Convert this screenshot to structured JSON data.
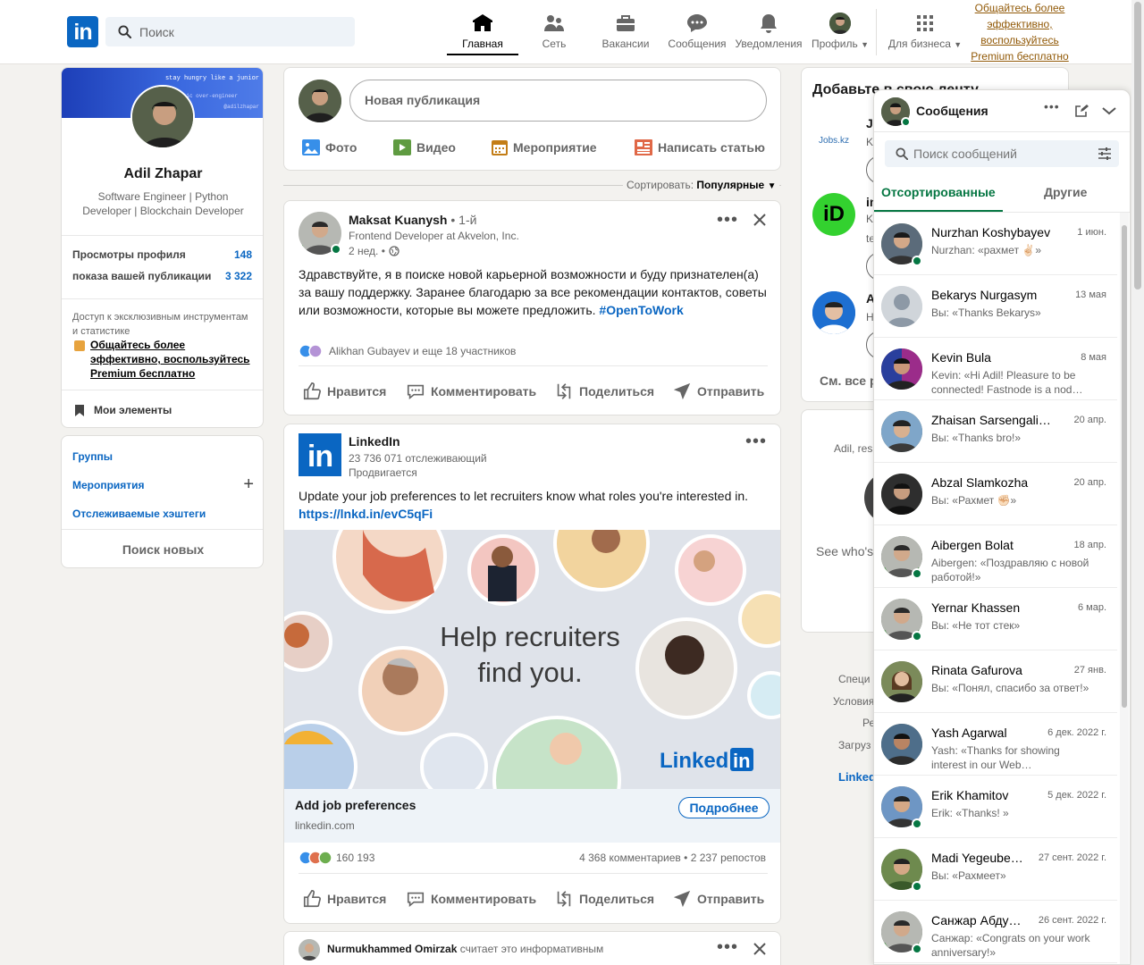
{
  "nav": {
    "search_placeholder": "Поиск",
    "items": [
      {
        "label": "Главная"
      },
      {
        "label": "Сеть"
      },
      {
        "label": "Вакансии"
      },
      {
        "label": "Сообщения"
      },
      {
        "label": "Уведомления"
      },
      {
        "label": "Профиль"
      },
      {
        "label": "Для бизнеса"
      }
    ],
    "premium_link": "Общайтесь более эффективно, воспользуйтесь Premium бесплатно",
    "logo": "in"
  },
  "profile": {
    "banner_line1": "stay hungry like a junior",
    "banner_line2": "empathic over-engineer",
    "banner_line3": "@adilzhapar",
    "name": "Adil Zhapar",
    "headline": "Software Engineer | Python Developer | Blockchain Developer",
    "stat1_label": "Просмотры профиля",
    "stat1_value": "148",
    "stat2_label": "показа вашей публикации",
    "stat2_value": "3 322",
    "premium_text": "Доступ к эксклюзивным инструментам и статистике",
    "premium_link": "Общайтесь более эффективно, воспользуйтесь Premium бесплатно",
    "my_items": "Мои элементы"
  },
  "side": {
    "groups": "Группы",
    "events": "Мероприятия",
    "hashtags": "Отслеживаемые хэштеги",
    "discover": "Поиск новых"
  },
  "composer": {
    "placeholder": "Новая публикация",
    "photo": "Фото",
    "video": "Видео",
    "event": "Мероприятие",
    "article": "Написать статью"
  },
  "sort": {
    "label": "Сортировать:",
    "value": "Популярные"
  },
  "post1": {
    "author": "Maksat Kuanysh",
    "degree": "• 1-й",
    "subtitle": "Frontend Developer at Akvelon, Inc.",
    "time": "2 нед. •",
    "text": "Здравствуйте, я в поиске новой карьерной возможности и буду признателен(а) за вашу поддержку. Заранее благодарю за все рекомендации контактов, советы или возможности, которые вы можете предложить.",
    "hashtag": "#OpenToWork",
    "reactions": "Alikhan Gubayev и еще 18 участников"
  },
  "actions": {
    "like": "Нравится",
    "comment": "Комментировать",
    "share": "Поделиться",
    "send": "Отправить"
  },
  "post2": {
    "author": "LinkedIn",
    "followers": "23 736 071 отслеживающий",
    "promoted": "Продвигается",
    "text": "Update your job preferences to let recruiters know what roles you're interested in.",
    "link": "https://lnkd.in/evC5qFi",
    "image_headline1": "Help recruiters",
    "image_headline2": "find you.",
    "image_brand": "Linked",
    "image_brand_in": "in",
    "cta_title": "Add job preferences",
    "cta_domain": "linkedin.com",
    "cta_button": "Подробнее",
    "reactions_count": "160 193",
    "comments": "4 368 комментариев",
    "dot": "•",
    "reposts": "2 237 репостов"
  },
  "post3": {
    "author": "Nurmukhammed Omirzak",
    "action": "считает это информативным"
  },
  "right": {
    "title": "Добавьте в свою ленту",
    "see_all": "См. все р",
    "jobs_logo": "Jobs.kz",
    "follow1": "Jo",
    "follow2": "in",
    "follow3": "A",
    "sub1": "K",
    "sub2": "K",
    "sub2b": "te",
    "sub3": "H",
    "card2_text": "Adil, res",
    "card2_text2": "See who's",
    "footer1": "Специ",
    "footer2": "Условия",
    "footer3": "Ре",
    "footer4": "Загруз",
    "footer5": "Linked"
  },
  "messaging": {
    "title": "Сообщения",
    "search_placeholder": "Поиск сообщений",
    "tab_focused": "Отсортированные",
    "tab_other": "Другие",
    "conversations": [
      {
        "name": "Nurzhan Koshybayev",
        "date": "1 июн.",
        "preview": "Nurzhan: «рахмет ✌🏻»"
      },
      {
        "name": "Bekarys Nurgasym",
        "date": "13 мая",
        "preview": "Вы: «Thanks Bekarys»"
      },
      {
        "name": "Kevin Bula",
        "date": "8 мая",
        "preview": "Kevin: «Hi Adil! Pleasure to be connected! Fastnode is a nod…"
      },
      {
        "name": "Zhaisan Sarsengaliyev",
        "date": "20 апр.",
        "preview": "Вы: «Thanks bro!»"
      },
      {
        "name": "Abzal Slamkozha",
        "date": "20 апр.",
        "preview": "Вы: «Рахмет ✊🏻»"
      },
      {
        "name": "Aibergen Bolat",
        "date": "18 апр.",
        "preview": "Aibergen: «Поздравляю с новой работой!»"
      },
      {
        "name": "Yernar Khassen",
        "date": "6 мар.",
        "preview": "Вы: «Не тот стек»"
      },
      {
        "name": "Rinata Gafurova",
        "date": "27 янв.",
        "preview": "Вы: «Понял, спасибо за ответ!»"
      },
      {
        "name": "Yash Agarwal",
        "date": "6 дек. 2022 г.",
        "preview": "Yash: «Thanks for showing interest in our Web…"
      },
      {
        "name": "Erik Khamitov",
        "date": "5 дек. 2022 г.",
        "preview": "Erik: «Thanks! »"
      },
      {
        "name": "Madi Yegeube…",
        "date": "27 сент. 2022 г.",
        "preview": "Вы: «Рахмеет»"
      },
      {
        "name": "Санжар Абду…",
        "date": "26 сент. 2022 г.",
        "preview": "Санжар: «Congrats on your work anniversary!»"
      }
    ]
  },
  "colors": {
    "brand": "#0a66c2",
    "online": "#057642",
    "premium": "#915907"
  }
}
